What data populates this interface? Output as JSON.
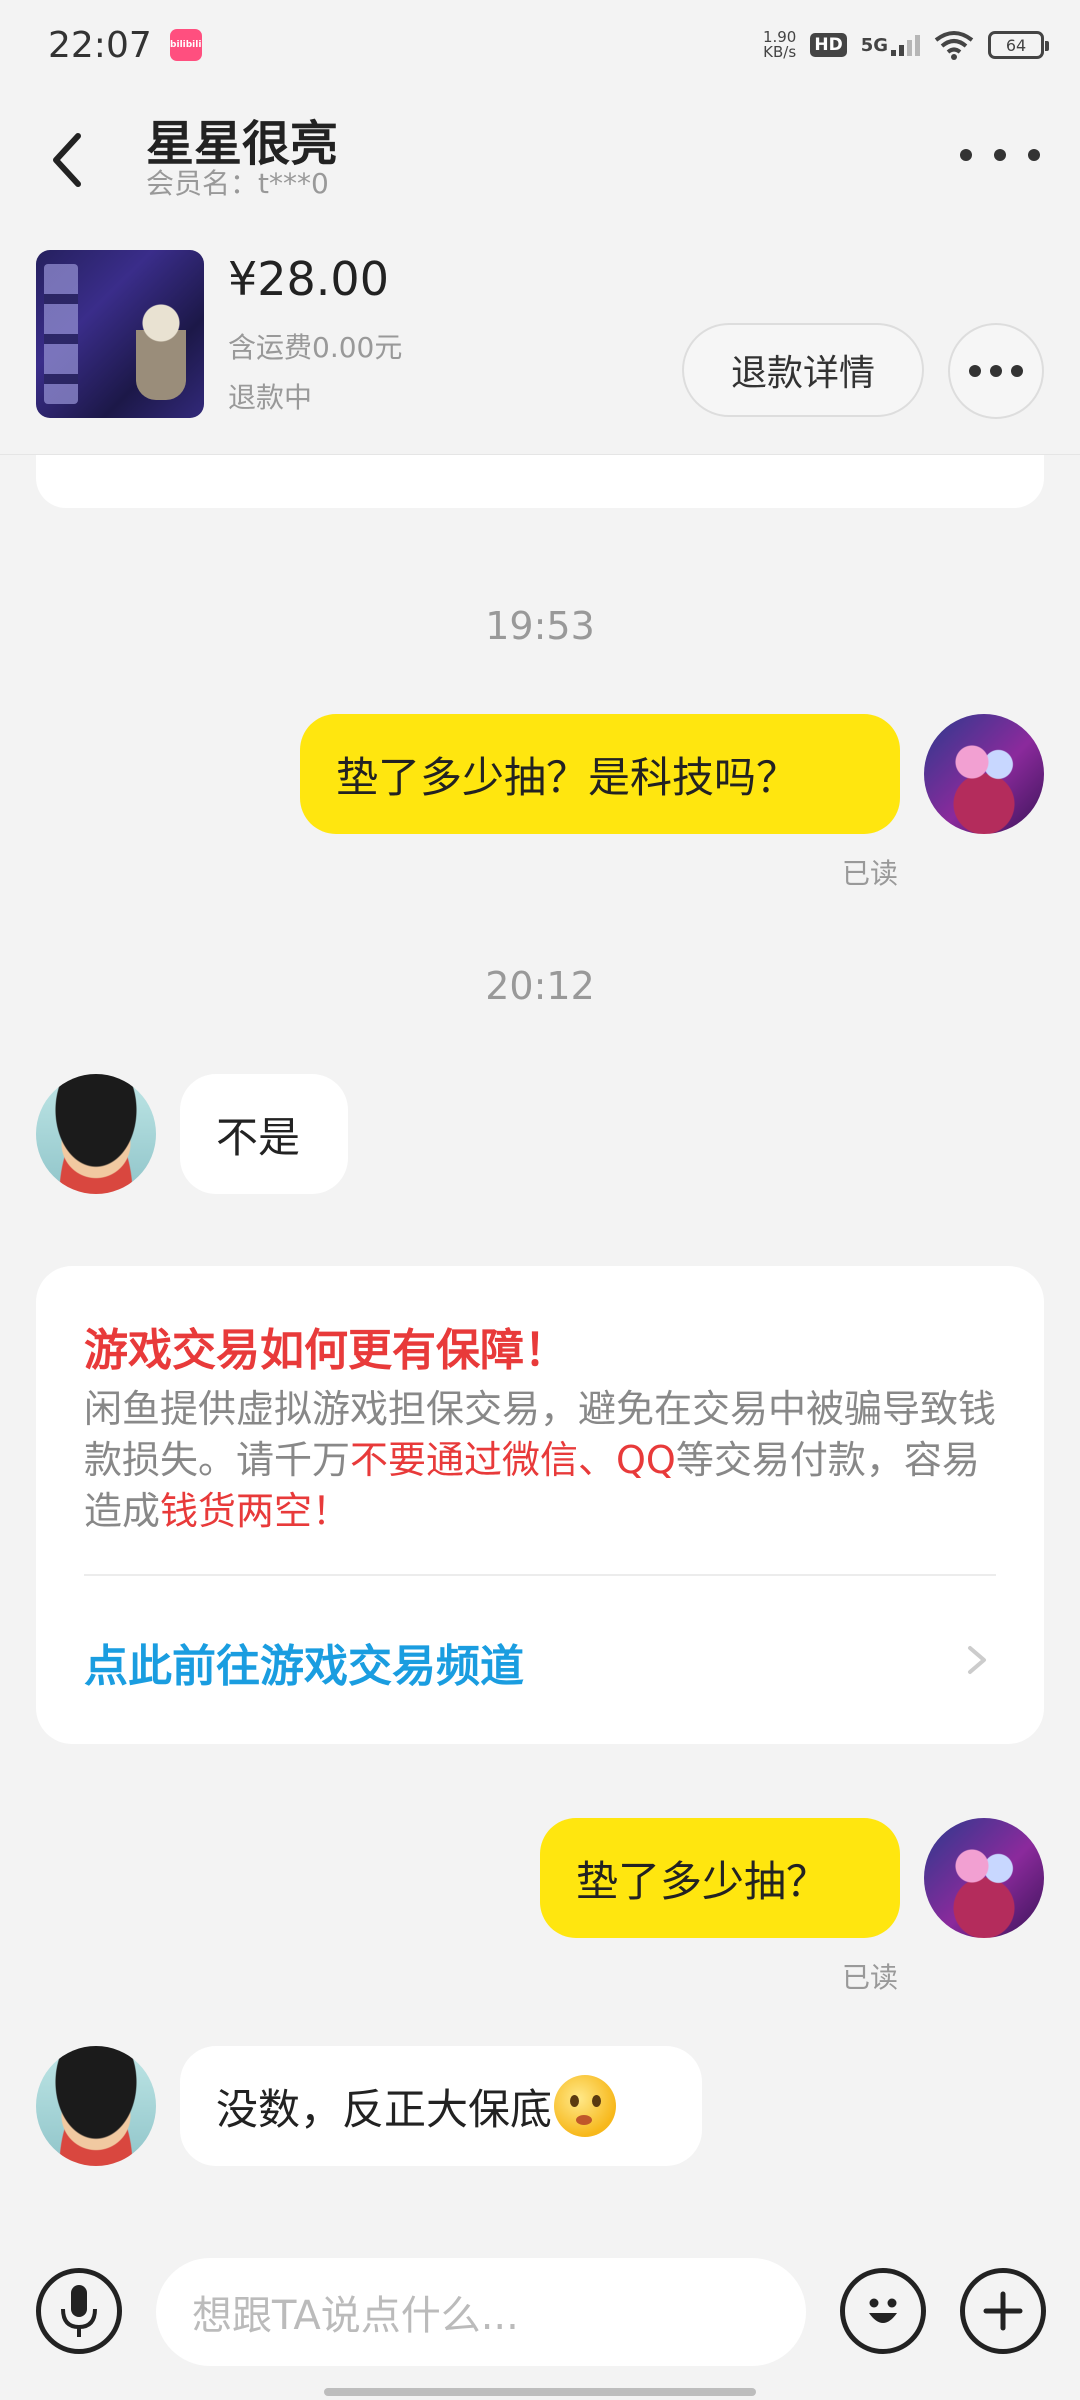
{
  "status_bar": {
    "time": "22:07",
    "app_badge": "bilibili",
    "net_speed_value": "1.90",
    "net_speed_unit": "KB/s",
    "hd": "HD",
    "network": "5G",
    "battery": "64"
  },
  "header": {
    "title": "星星很亮",
    "member_label": "会员名：t***0"
  },
  "product": {
    "price": "¥28.00",
    "shipping": "含运费0.00元",
    "status": "退款中",
    "refund_button": "退款详情"
  },
  "messages": {
    "time_1": "19:53",
    "msg_1": "垫了多少抽？是科技吗？",
    "read_1": "已读",
    "time_2": "20:12",
    "reply_1": "不是",
    "msg_2": "垫了多少抽？",
    "read_2": "已读",
    "reply_2": "没数，反正大保底"
  },
  "notice": {
    "title": "游戏交易如何更有保障！",
    "body_1": "闲鱼提供虚拟游戏担保交易，避免在交易中被骗导致钱款损失。请千万",
    "body_red_1": "不要通过微信、QQ",
    "body_2": "等交易付款，容易造成",
    "body_red_2": "钱货两空",
    "body_3": "！",
    "link": "点此前往游戏交易频道"
  },
  "input_bar": {
    "placeholder": "想跟TA说点什么..."
  },
  "colors": {
    "bubble_me": "#ffe60f",
    "alert_red": "#e83a3a",
    "link_blue": "#1a9de0",
    "background": "#f3f3f3"
  },
  "icons": [
    "back-arrow-icon",
    "more-icon",
    "microphone-icon",
    "emoji-icon",
    "plus-icon",
    "chevron-right-icon"
  ]
}
